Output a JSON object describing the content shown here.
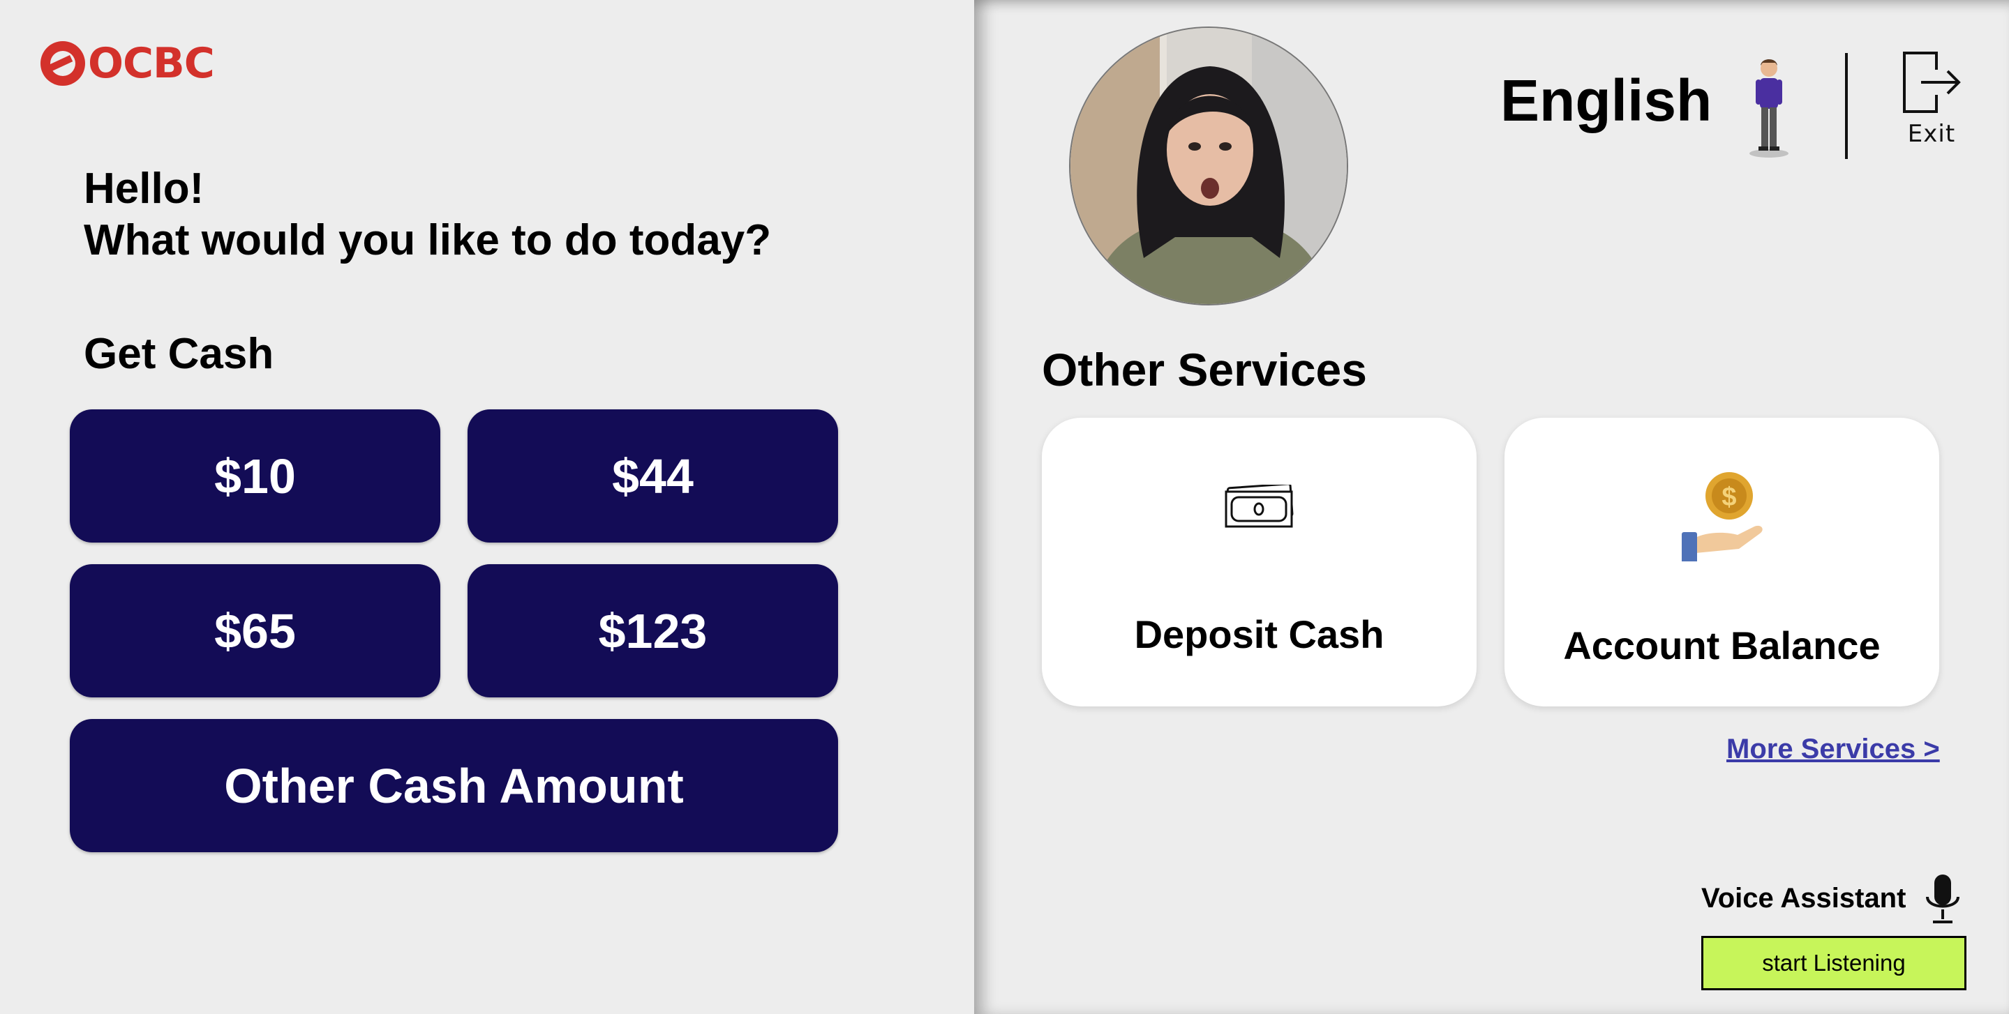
{
  "brand": {
    "name": "OCBC",
    "color": "#d3312b",
    "icon": "ocbc-logo-icon"
  },
  "greeting": {
    "line1": "Hello!",
    "line2": "What would you like to do today?"
  },
  "get_cash": {
    "title": "Get Cash",
    "amounts": [
      "$10",
      "$44",
      "$65",
      "$123"
    ],
    "other_label": "Other Cash Amount",
    "button_color": "#130c56"
  },
  "header": {
    "language": "English",
    "assistant_icon": "standing-person-icon",
    "exit_label": "Exit",
    "exit_icon": "exit-door-icon"
  },
  "user": {
    "avatar_icon": "user-camera-avatar"
  },
  "other_services": {
    "title": "Other Services",
    "cards": [
      {
        "label": "Deposit Cash",
        "icon": "banknote-icon"
      },
      {
        "label": "Account Balance",
        "icon": "coin-hand-icon"
      }
    ],
    "more_label": "More Services >",
    "link_color": "#3b3ba8"
  },
  "voice": {
    "label": "Voice Assistant",
    "icon": "microphone-icon",
    "button_label": "start Listening",
    "button_color": "#c7f55a"
  }
}
